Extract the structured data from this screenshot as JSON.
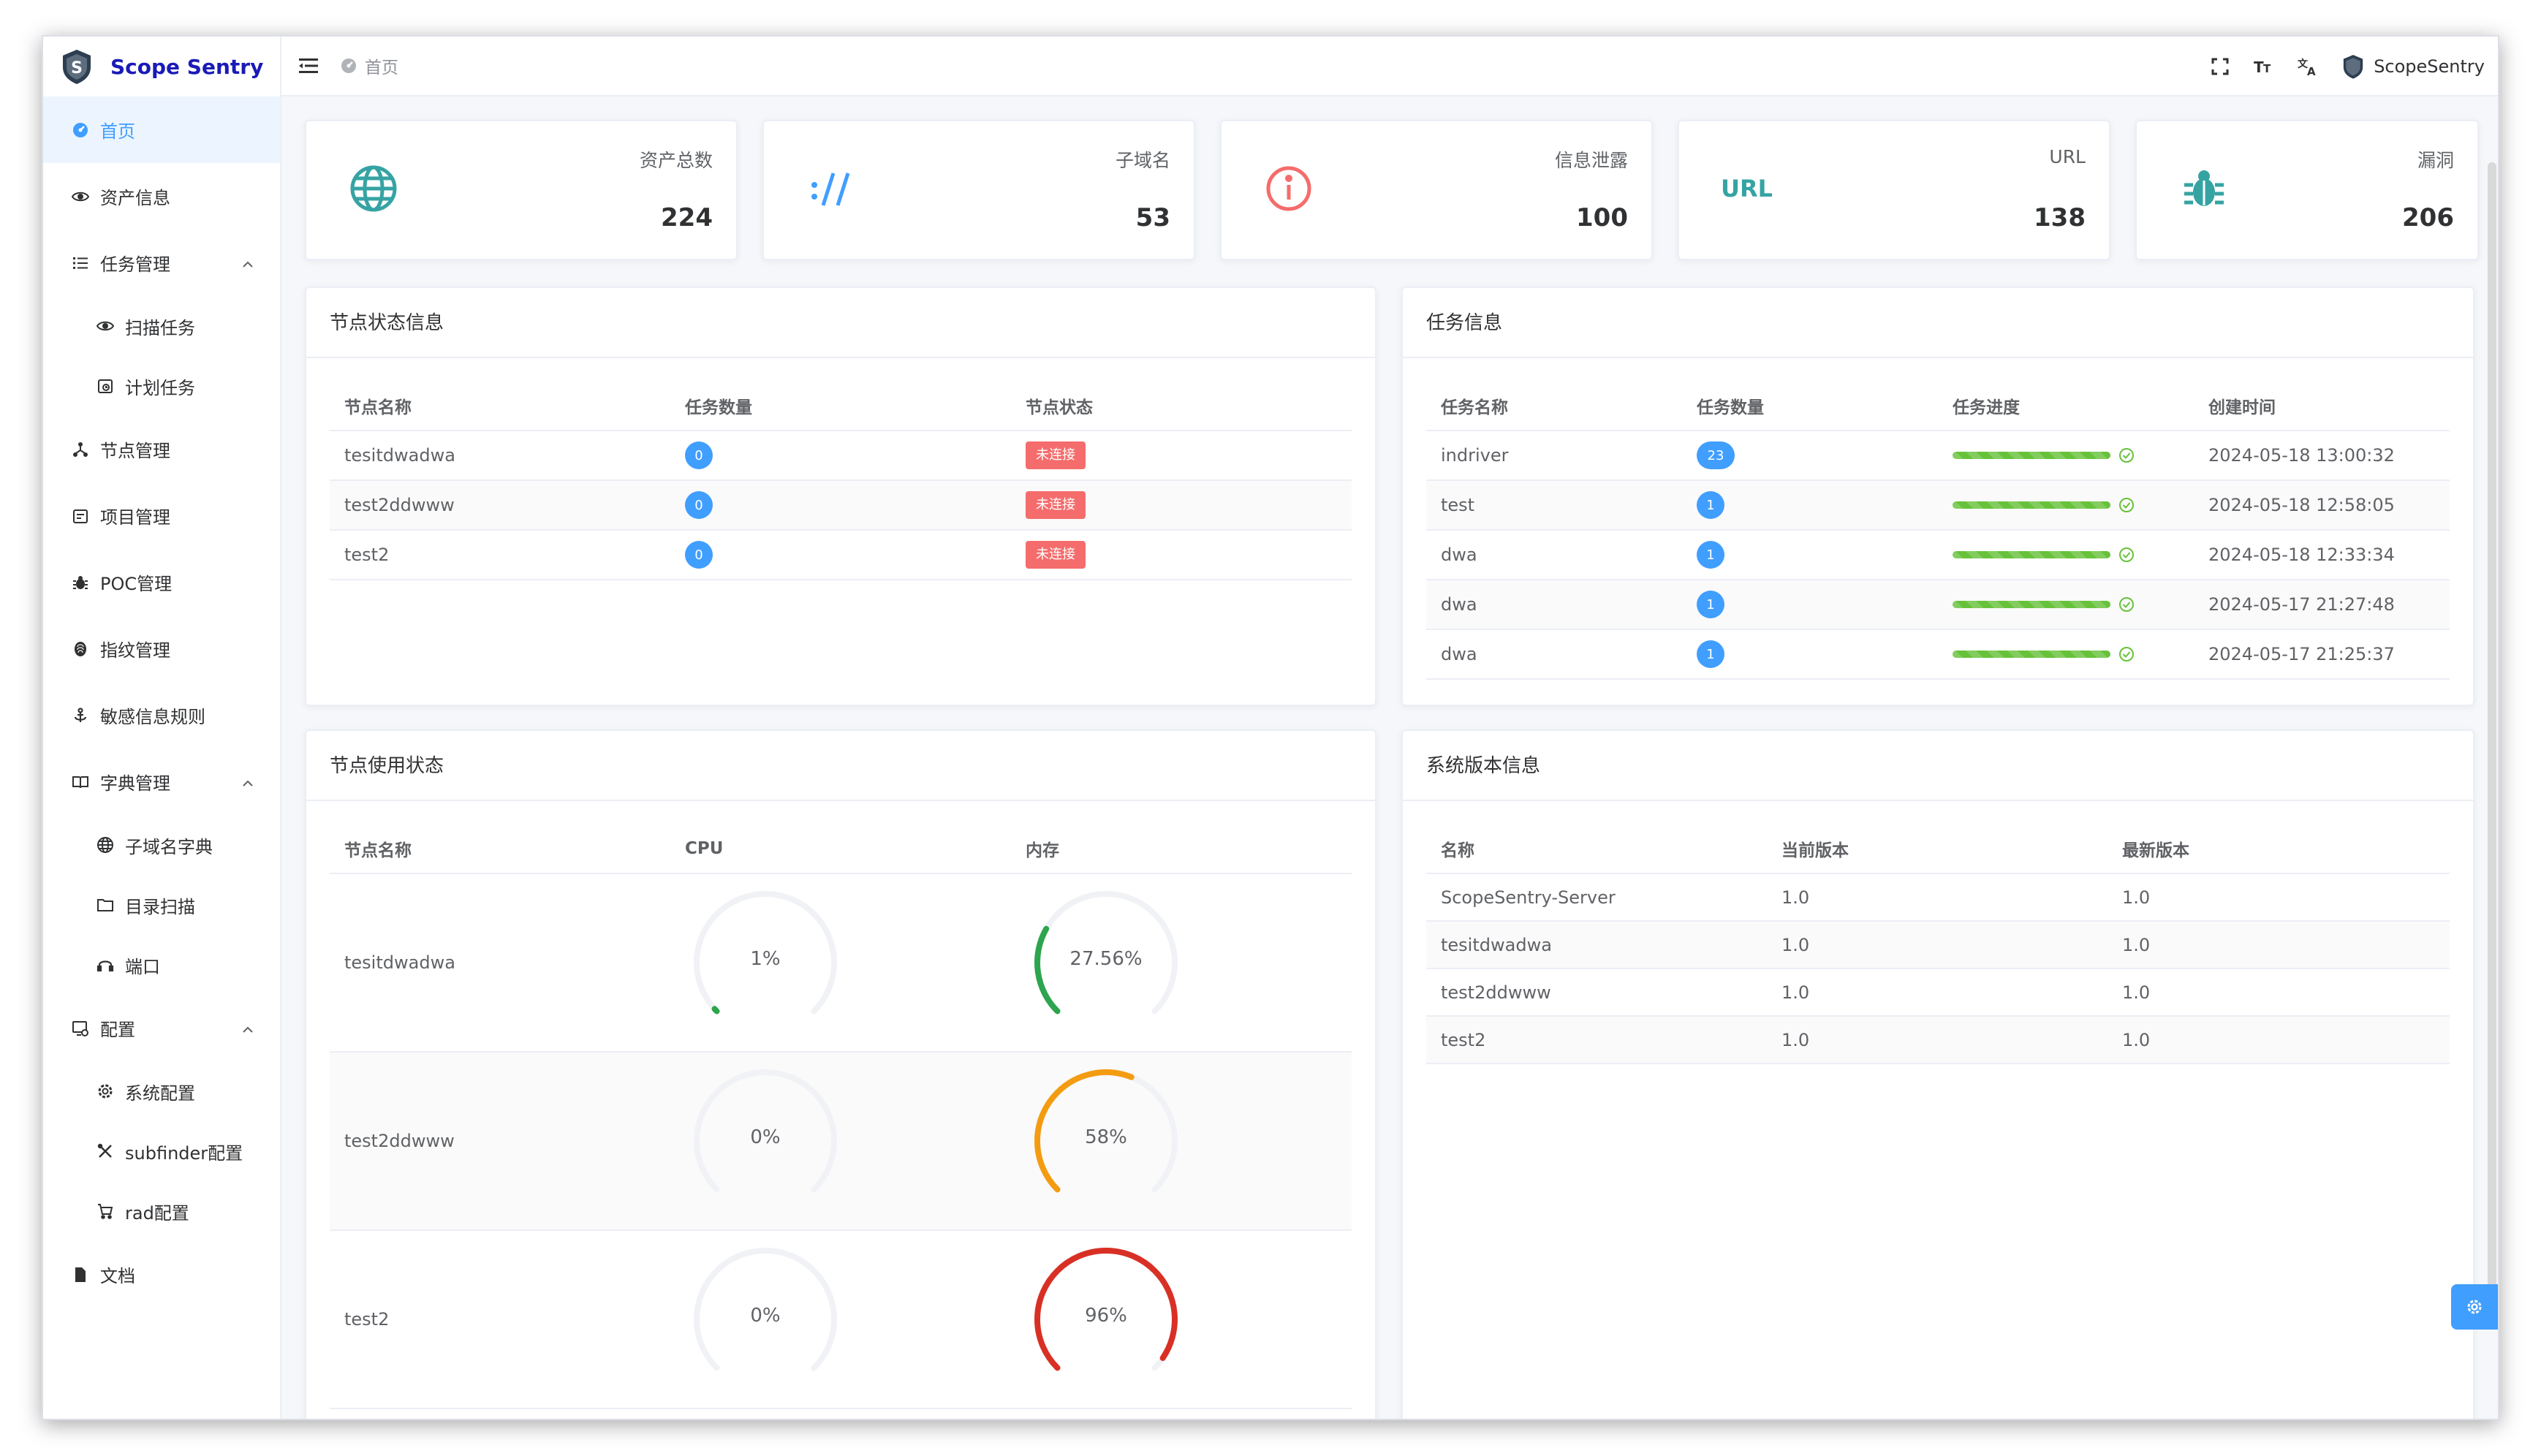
{
  "app": {
    "name": "Scope Sentry"
  },
  "sidebar": {
    "items": [
      {
        "label": "首页",
        "icon": "dashboard-icon",
        "active": true
      },
      {
        "label": "资产信息",
        "icon": "eye-icon"
      },
      {
        "label": "任务管理",
        "icon": "list-icon",
        "expandable": true
      },
      {
        "label": "扫描任务",
        "icon": "eye-icon",
        "sub": true
      },
      {
        "label": "计划任务",
        "icon": "schedule-icon",
        "sub": true
      },
      {
        "label": "节点管理",
        "icon": "nodes-icon"
      },
      {
        "label": "项目管理",
        "icon": "project-icon"
      },
      {
        "label": "POC管理",
        "icon": "bug-icon"
      },
      {
        "label": "指纹管理",
        "icon": "fingerprint-icon"
      },
      {
        "label": "敏感信息规则",
        "icon": "anchor-icon"
      },
      {
        "label": "字典管理",
        "icon": "book-icon",
        "expandable": true
      },
      {
        "label": "子域名字典",
        "icon": "globe-icon",
        "sub": true
      },
      {
        "label": "目录扫描",
        "icon": "folder-icon",
        "sub": true
      },
      {
        "label": "端口",
        "icon": "headset-icon",
        "sub": true
      },
      {
        "label": "配置",
        "icon": "config-icon",
        "expandable": true
      },
      {
        "label": "系统配置",
        "icon": "gear-icon",
        "sub": true
      },
      {
        "label": "subfinder配置",
        "icon": "tools-icon",
        "sub": true
      },
      {
        "label": "rad配置",
        "icon": "cart-icon",
        "sub": true
      },
      {
        "label": "文档",
        "icon": "document-icon"
      }
    ]
  },
  "header": {
    "breadcrumb": "首页",
    "user": "ScopeSentry"
  },
  "stats": [
    {
      "label": "资产总数",
      "value": "224",
      "icon": "globe-icon",
      "color": "#36a3a3"
    },
    {
      "label": "子域名",
      "value": "53",
      "icon": "subdomain-icon",
      "color": "#409eff"
    },
    {
      "label": "信息泄露",
      "value": "100",
      "icon": "info-icon",
      "color": "#f56c6c"
    },
    {
      "label": "URL",
      "value": "138",
      "icon": "url-icon",
      "color": "#36a3a3"
    },
    {
      "label": "漏洞",
      "value": "206",
      "icon": "bug-icon",
      "color": "#36a3a3"
    }
  ],
  "node_status": {
    "title": "节点状态信息",
    "columns": [
      "节点名称",
      "任务数量",
      "节点状态"
    ],
    "rows": [
      {
        "name": "tesitdwadwa",
        "tasks": "0",
        "status": "未连接"
      },
      {
        "name": "test2ddwww",
        "tasks": "0",
        "status": "未连接"
      },
      {
        "name": "test2",
        "tasks": "0",
        "status": "未连接"
      }
    ]
  },
  "task_info": {
    "title": "任务信息",
    "columns": [
      "任务名称",
      "任务数量",
      "任务进度",
      "创建时间"
    ],
    "rows": [
      {
        "name": "indriver",
        "count": "23",
        "progress": 1.0,
        "created": "2024-05-18 13:00:32"
      },
      {
        "name": "test",
        "count": "1",
        "progress": 1.0,
        "created": "2024-05-18 12:58:05"
      },
      {
        "name": "dwa",
        "count": "1",
        "progress": 1.0,
        "created": "2024-05-18 12:33:34"
      },
      {
        "name": "dwa",
        "count": "1",
        "progress": 1.0,
        "created": "2024-05-17 21:27:48"
      },
      {
        "name": "dwa",
        "count": "1",
        "progress": 1.0,
        "created": "2024-05-17 21:25:37"
      }
    ]
  },
  "node_usage": {
    "title": "节点使用状态",
    "columns": [
      "节点名称",
      "CPU",
      "内存"
    ],
    "rows": [
      {
        "name": "tesitdwadwa",
        "cpu_label": "1%",
        "cpu": 1,
        "mem_label": "27.56%",
        "mem": 27.56,
        "mem_color": "#2da44e"
      },
      {
        "name": "test2ddwww",
        "cpu_label": "0%",
        "cpu": 0,
        "mem_label": "58%",
        "mem": 58,
        "mem_color": "#f39c12"
      },
      {
        "name": "test2",
        "cpu_label": "0%",
        "cpu": 0,
        "mem_label": "96%",
        "mem": 96,
        "mem_color": "#d93025"
      }
    ],
    "cpu_color": "#2da44e"
  },
  "version_info": {
    "title": "系统版本信息",
    "columns": [
      "名称",
      "当前版本",
      "最新版本"
    ],
    "rows": [
      {
        "name": "ScopeSentry-Server",
        "current": "1.0",
        "latest": "1.0"
      },
      {
        "name": "tesitdwadwa",
        "current": "1.0",
        "latest": "1.0"
      },
      {
        "name": "test2ddwww",
        "current": "1.0",
        "latest": "1.0"
      },
      {
        "name": "test2",
        "current": "1.0",
        "latest": "1.0"
      }
    ]
  }
}
